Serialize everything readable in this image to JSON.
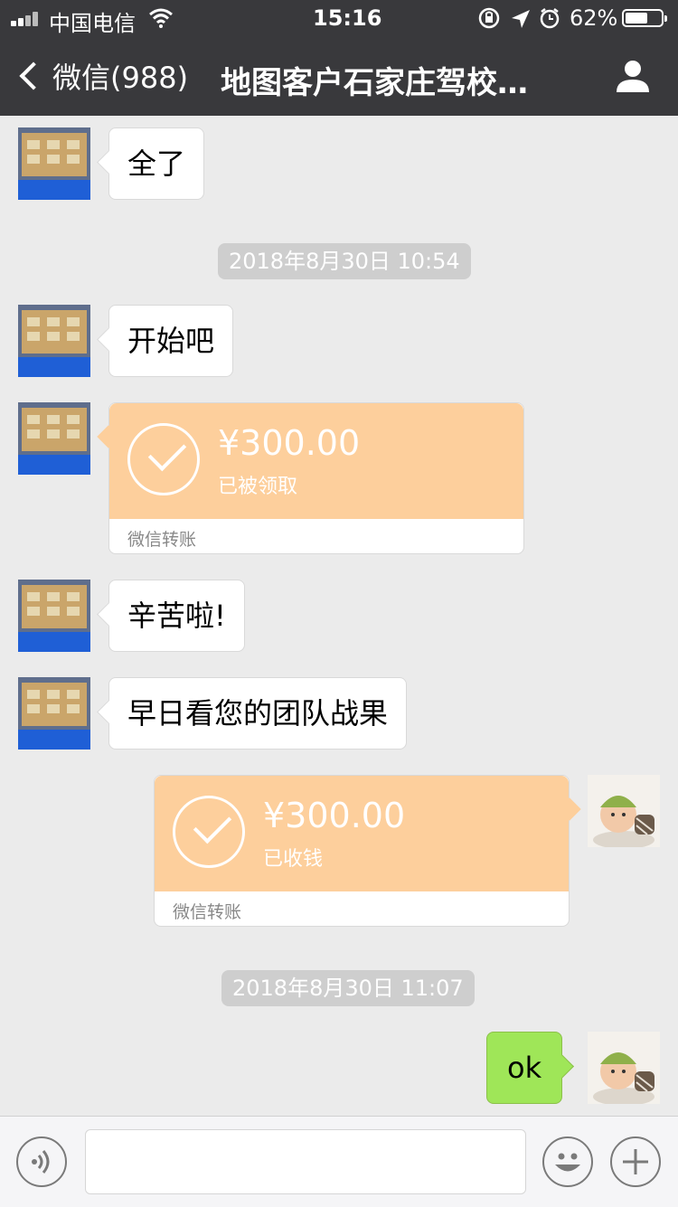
{
  "status_bar": {
    "carrier": "中国电信",
    "time": "15:16",
    "battery_percent": "62%",
    "battery_level": 0.62
  },
  "nav": {
    "back_label": "微信(988)",
    "title": "地图客户石家庄驾校…"
  },
  "messages": [
    {
      "type": "text",
      "sender": "other",
      "text": "全了"
    },
    {
      "type": "timestamp",
      "text": "2018年8月30日 10:54"
    },
    {
      "type": "text",
      "sender": "other",
      "text": "开始吧"
    },
    {
      "type": "transfer",
      "sender": "other",
      "amount": "¥300.00",
      "status": "已被领取",
      "footer": "微信转账"
    },
    {
      "type": "text",
      "sender": "other",
      "text": "辛苦啦!"
    },
    {
      "type": "text",
      "sender": "other",
      "text": "早日看您的团队战果"
    },
    {
      "type": "transfer",
      "sender": "me",
      "amount": "¥300.00",
      "status": "已收钱",
      "footer": "微信转账"
    },
    {
      "type": "timestamp",
      "text": "2018年8月30日 11:07"
    },
    {
      "type": "text",
      "sender": "me",
      "text": "ok"
    }
  ],
  "input_bar": {
    "input_value": "",
    "icons": [
      "voice-icon",
      "emoji-icon",
      "plus-icon"
    ]
  },
  "colors": {
    "header": "#39393c",
    "background": "#ebebeb",
    "transfer_orange": "#fdcf9c",
    "my_bubble_green": "#9fe658"
  }
}
